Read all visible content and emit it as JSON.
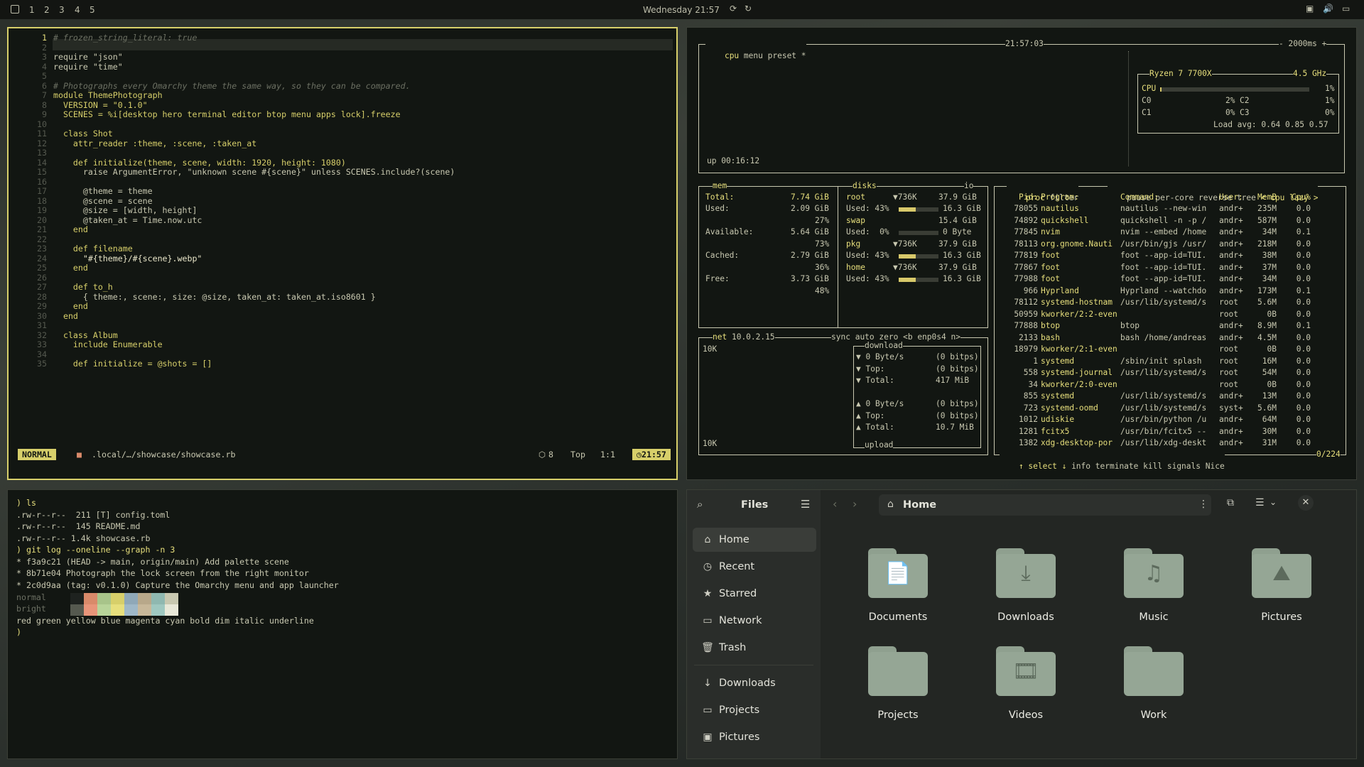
{
  "topbar": {
    "workspaces": [
      "1",
      "2",
      "3",
      "4",
      "5"
    ],
    "clock": "Wednesday 21:57"
  },
  "nvim": {
    "lines": [
      {
        "n": "1",
        "t": "# frozen_string_literal: true",
        "c": "cm"
      },
      {
        "n": "2",
        "t": "",
        "c": "sym"
      },
      {
        "n": "3",
        "t": "require \"json\"",
        "c": "sym"
      },
      {
        "n": "4",
        "t": "require \"time\"",
        "c": "sym"
      },
      {
        "n": "5",
        "t": "",
        "c": "sym"
      },
      {
        "n": "6",
        "t": "# Photographs every Omarchy theme the same way, so they can be compared.",
        "c": "cm"
      },
      {
        "n": "7",
        "t": "module ThemePhotograph",
        "c": "kw"
      },
      {
        "n": "8",
        "t": "  VERSION = \"0.1.0\"",
        "c": "kw"
      },
      {
        "n": "9",
        "t": "  SCENES = %i[desktop hero terminal editor btop menu apps lock].freeze",
        "c": "kw"
      },
      {
        "n": "10",
        "t": "",
        "c": "sym"
      },
      {
        "n": "11",
        "t": "  class Shot",
        "c": "kw"
      },
      {
        "n": "12",
        "t": "    attr_reader :theme, :scene, :taken_at",
        "c": "kw"
      },
      {
        "n": "13",
        "t": "",
        "c": "sym"
      },
      {
        "n": "14",
        "t": "    def initialize(theme, scene, width: 1920, height: 1080)",
        "c": "kw"
      },
      {
        "n": "15",
        "t": "      raise ArgumentError, \"unknown scene #{scene}\" unless SCENES.include?(scene)",
        "c": "sym"
      },
      {
        "n": "16",
        "t": "",
        "c": "sym"
      },
      {
        "n": "17",
        "t": "      @theme = theme",
        "c": "sym"
      },
      {
        "n": "18",
        "t": "      @scene = scene",
        "c": "sym"
      },
      {
        "n": "19",
        "t": "      @size = [width, height]",
        "c": "sym"
      },
      {
        "n": "20",
        "t": "      @taken_at = Time.now.utc",
        "c": "sym"
      },
      {
        "n": "21",
        "t": "    end",
        "c": "kw"
      },
      {
        "n": "22",
        "t": "",
        "c": "sym"
      },
      {
        "n": "23",
        "t": "    def filename",
        "c": "kw"
      },
      {
        "n": "24",
        "t": "      \"#{theme}/#{scene}.webp\"",
        "c": "str"
      },
      {
        "n": "25",
        "t": "    end",
        "c": "kw"
      },
      {
        "n": "26",
        "t": "",
        "c": "sym"
      },
      {
        "n": "27",
        "t": "    def to_h",
        "c": "kw"
      },
      {
        "n": "28",
        "t": "      { theme:, scene:, size: @size, taken_at: taken_at.iso8601 }",
        "c": "sym"
      },
      {
        "n": "29",
        "t": "    end",
        "c": "kw"
      },
      {
        "n": "30",
        "t": "  end",
        "c": "kw"
      },
      {
        "n": "31",
        "t": "",
        "c": "sym"
      },
      {
        "n": "32",
        "t": "  class Album",
        "c": "kw"
      },
      {
        "n": "33",
        "t": "    include Enumerable",
        "c": "kw"
      },
      {
        "n": "34",
        "t": "",
        "c": "sym"
      },
      {
        "n": "35",
        "t": "    def initialize = @shots = []",
        "c": "kw"
      }
    ],
    "status": {
      "mode": "NORMAL",
      "path": ".local/…/showcase/showcase.rb",
      "count": "8",
      "pos": "Top",
      "cursor": "1:1",
      "time": "21:57"
    }
  },
  "term2": {
    "lines": [
      ") ls",
      ".rw-r--r--  211 [T] config.toml",
      ".rw-r--r--  145 README.md",
      ".rw-r--r-- 1.4k showcase.rb",
      ") git log --oneline --graph -n 3",
      "* f3a9c21 (HEAD -> main, origin/main) Add palette scene",
      "* 8b71e04 Photograph the lock screen from the right monitor",
      "* 2c0d9aa (tag: v0.1.0) Capture the Omarchy menu and app launcher",
      "normal",
      "bright",
      "red green yellow blue magenta cyan bold dim italic underline",
      ")"
    ],
    "palette_normal": [
      "#1e221f",
      "#d98a6a",
      "#a8c48a",
      "#d7cf6a",
      "#8fa8b8",
      "#b8a88a",
      "#8fb8b0",
      "#c8c8b0"
    ],
    "palette_bright": [
      "#55594f",
      "#e8957a",
      "#b8d49a",
      "#e7df7c",
      "#9fb8c8",
      "#c8b89a",
      "#9fc8c0",
      "#e8e8d8"
    ]
  },
  "btop": {
    "cpu_header": [
      "cpu",
      "menu",
      "preset *",
      "21:57:03",
      "- 2000ms +"
    ],
    "cpu_title": "Ryzen 7 7700X",
    "cpu_freq": "4.5 GHz",
    "cpu_rows": [
      [
        "CPU",
        "1%"
      ],
      [
        "C0",
        "2%",
        "C2",
        "1%"
      ],
      [
        "C1",
        "0%",
        "C3",
        "0%"
      ]
    ],
    "load": "Load avg: 0.64 0.85 0.57",
    "uptime": "up 00:16:12",
    "mem": {
      "title": "mem",
      "total": "7.74 GiB",
      "used": "2.09 GiB",
      "used_pct": "27%",
      "avail": "5.64 GiB",
      "avail_pct": "73%",
      "cached": "2.79 GiB",
      "cached_pct": "36%",
      "free": "3.73 GiB",
      "free_pct": "48%"
    },
    "disks": {
      "title": "disks",
      "io": "io",
      "rows": [
        {
          "name": "root",
          "io": "▼736K",
          "size": "37.9 GiB",
          "used": "Used: 43%",
          "free": "16.3 GiB",
          "pct": 0.43
        },
        {
          "name": "swap",
          "io": "",
          "size": "15.4 GiB",
          "used": "Used:  0%",
          "free": "0 Byte",
          "pct": 0.0
        },
        {
          "name": "pkg",
          "io": "▼736K",
          "size": "37.9 GiB",
          "used": "Used: 43%",
          "free": "16.3 GiB",
          "pct": 0.43
        },
        {
          "name": "home",
          "io": "▼736K",
          "size": "37.9 GiB",
          "used": "Used: 43%",
          "free": "16.3 GiB",
          "pct": 0.43
        }
      ]
    },
    "net": {
      "title": "net",
      "ip": "10.0.2.15",
      "opts": [
        "sync",
        "auto",
        "zero",
        "<b enp0s4 n>"
      ],
      "scale": "10K",
      "scale2": "10K",
      "download": "download",
      "upload": "upload",
      "d_rows": [
        [
          "▼ 0 Byte/s",
          "(0 bitps)"
        ],
        [
          "▼ Top:",
          "(0 bitps)"
        ],
        [
          "▼ Total:",
          "417 MiB"
        ]
      ],
      "u_rows": [
        [
          "▲ 0 Byte/s",
          "(0 bitps)"
        ],
        [
          "▲ Top:",
          "(0 bitps)"
        ],
        [
          "▲ Total:",
          "10.7 MiB"
        ]
      ]
    },
    "proc": {
      "header": [
        "proc",
        "filter",
        "pause",
        "per-core",
        "reverse",
        "tree",
        "< cpu lazy >"
      ],
      "cols": [
        "Pid:",
        "Program:",
        "Command:",
        "User:",
        "MemB",
        "Cpu%"
      ],
      "rows": [
        [
          "78055",
          "nautilus",
          "nautilus --new-win",
          "andr+",
          "235M",
          "0.0"
        ],
        [
          "74892",
          "quickshell",
          "quickshell -n -p /",
          "andr+",
          "587M",
          "0.0"
        ],
        [
          "77845",
          "nvim",
          "nvim --embed /home",
          "andr+",
          "34M",
          "0.1"
        ],
        [
          "78113",
          "org.gnome.Nauti",
          "/usr/bin/gjs /usr/",
          "andr+",
          "218M",
          "0.0"
        ],
        [
          "77819",
          "foot",
          "foot --app-id=TUI.",
          "andr+",
          "38M",
          "0.0"
        ],
        [
          "77867",
          "foot",
          "foot --app-id=TUI.",
          "andr+",
          "37M",
          "0.0"
        ],
        [
          "77988",
          "foot",
          "foot --app-id=TUI.",
          "andr+",
          "34M",
          "0.0"
        ],
        [
          "966",
          "Hyprland",
          "Hyprland --watchdo",
          "andr+",
          "173M",
          "0.1"
        ],
        [
          "78112",
          "systemd-hostnam",
          "/usr/lib/systemd/s",
          "root",
          "5.6M",
          "0.0"
        ],
        [
          "50959",
          "kworker/2:2-even",
          "",
          "root",
          "0B",
          "0.0"
        ],
        [
          "77888",
          "btop",
          "btop",
          "andr+",
          "8.9M",
          "0.1"
        ],
        [
          "2133",
          "bash",
          "bash /home/andreas",
          "andr+",
          "4.5M",
          "0.0"
        ],
        [
          "18979",
          "kworker/2:1-even",
          "",
          "root",
          "0B",
          "0.0"
        ],
        [
          "1",
          "systemd",
          "/sbin/init splash",
          "root",
          "16M",
          "0.0"
        ],
        [
          "558",
          "systemd-journal",
          "/usr/lib/systemd/s",
          "root",
          "54M",
          "0.0"
        ],
        [
          "34",
          "kworker/2:0-even",
          "",
          "root",
          "0B",
          "0.0"
        ],
        [
          "855",
          "systemd",
          "/usr/lib/systemd/s",
          "andr+",
          "13M",
          "0.0"
        ],
        [
          "723",
          "systemd-oomd",
          "/usr/lib/systemd/s",
          "syst+",
          "5.6M",
          "0.0"
        ],
        [
          "1012",
          "udiskie",
          "/usr/bin/python /u",
          "andr+",
          "64M",
          "0.0"
        ],
        [
          "1281",
          "fcitx5",
          "/usr/bin/fcitx5 --",
          "andr+",
          "30M",
          "0.0"
        ],
        [
          "1382",
          "xdg-desktop-por",
          "/usr/lib/xdg-deskt",
          "andr+",
          "31M",
          "0.0"
        ]
      ],
      "footer": [
        "↑ select ↓",
        "info",
        "terminate",
        "kill",
        "signals",
        "Nice",
        "0/224"
      ]
    }
  },
  "files": {
    "title": "Files",
    "location": "Home",
    "sidebar": [
      {
        "label": "Home",
        "icon": "⌂"
      },
      {
        "label": "Recent",
        "icon": "◷"
      },
      {
        "label": "Starred",
        "icon": "★"
      },
      {
        "label": "Network",
        "icon": "▭"
      },
      {
        "label": "Trash",
        "icon": "🗑"
      }
    ],
    "bookmarks": [
      {
        "label": "Downloads",
        "icon": "↓"
      },
      {
        "label": "Projects",
        "icon": "▭"
      },
      {
        "label": "Pictures",
        "icon": "▣"
      }
    ],
    "folders": [
      {
        "label": "Documents",
        "glyph": "📄"
      },
      {
        "label": "Downloads",
        "glyph": "⤓"
      },
      {
        "label": "Music",
        "glyph": "♫"
      },
      {
        "label": "Pictures",
        "glyph": "⛰"
      },
      {
        "label": "Projects",
        "glyph": ""
      },
      {
        "label": "Videos",
        "glyph": "🎞"
      },
      {
        "label": "Work",
        "glyph": ""
      }
    ]
  }
}
